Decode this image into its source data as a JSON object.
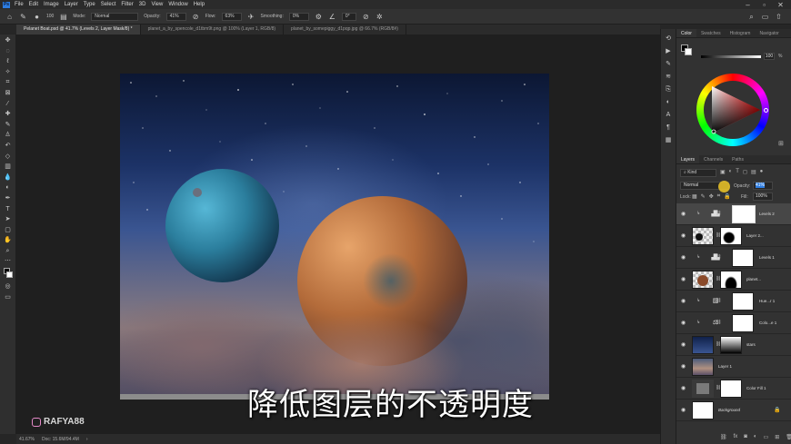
{
  "menubar": {
    "logo": "Ps",
    "items": [
      "File",
      "Edit",
      "Image",
      "Layer",
      "Type",
      "Select",
      "Filter",
      "3D",
      "View",
      "Window",
      "Help"
    ]
  },
  "options": {
    "size_value": "100",
    "mode_label": "Mode:",
    "mode_value": "Normal",
    "opacity_label": "Opacity:",
    "opacity_value": "41%",
    "flow_label": "Flow:",
    "flow_value": "63%",
    "smoothing_label": "Smoothing:",
    "smoothing_value": "0%",
    "angle_value": "0°"
  },
  "tabs": [
    {
      "label": "Pelanet Boat.psd @ 41.7% (Levels 2, Layer Mask/8) *"
    },
    {
      "label": "planet_a_by_spencole_d1tbm9t.png @ 100% (Layer 1, RGB/8)"
    },
    {
      "label": "planet_by_somepiggy_d1pqp.jpg @ 66.7% (RGB/8#)"
    }
  ],
  "status": {
    "zoom": "41.67%",
    "doc": "Doc: 15.6M/94.4M"
  },
  "subtitle": "降低图层的不透明度",
  "watermark": "RAFYA88",
  "color_panel": {
    "tabs": [
      "Color",
      "Swatches",
      "Histogram",
      "Navigator"
    ],
    "brightness_value": "100",
    "percent": "%"
  },
  "layers_panel": {
    "tabs": [
      "Layers",
      "Channels",
      "Paths"
    ],
    "kind_label": "Kind",
    "blend_mode": "Normal",
    "opacity_label": "Opacity:",
    "opacity_value": "41%",
    "lock_label": "Lock:",
    "fill_label": "Fill:",
    "fill_value": "100%",
    "layers": [
      {
        "name": "Levels 2"
      },
      {
        "name": "Layer 2..."
      },
      {
        "name": "Levels 1"
      },
      {
        "name": "planet..."
      },
      {
        "name": "Hue...r 1"
      },
      {
        "name": "Colo...e 1"
      },
      {
        "name": "stars"
      },
      {
        "name": "Layer 1"
      },
      {
        "name": "Color Fill 1"
      },
      {
        "name": "Background"
      }
    ]
  },
  "colors": {
    "accent": "#2d7ce0",
    "panel": "#323232",
    "selected_layer": "#474747"
  }
}
